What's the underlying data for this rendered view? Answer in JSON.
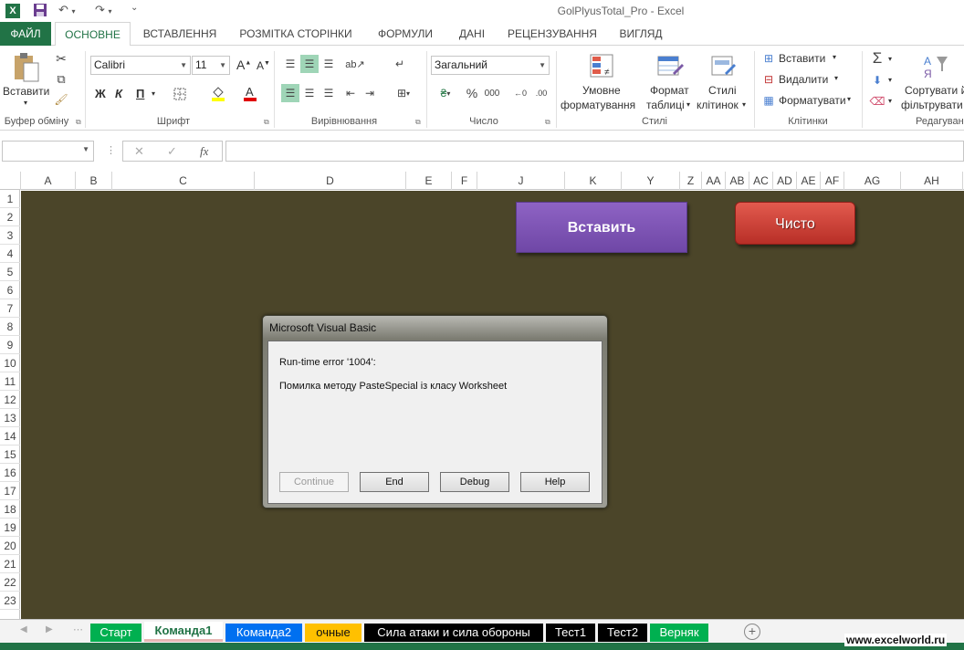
{
  "window": {
    "title": "GolPlyusTotal_Pro - Excel"
  },
  "ribbon_tabs": [
    "ФАЙЛ",
    "ОСНОВНЕ",
    "ВСТАВЛЕННЯ",
    "РОЗМІТКА СТОРІНКИ",
    "ФОРМУЛИ",
    "ДАНІ",
    "РЕЦЕНЗУВАННЯ",
    "ВИГЛЯД"
  ],
  "ribbon": {
    "clipboard": {
      "paste_label": "Вставити",
      "group_label": "Буфер обміну"
    },
    "font": {
      "name": "Calibri",
      "size": "11",
      "bold": "Ж",
      "italic": "К",
      "underline": "П",
      "group_label": "Шрифт"
    },
    "alignment": {
      "group_label": "Вирівнювання"
    },
    "number": {
      "format": "Загальний",
      "group_label": "Число"
    },
    "styles": {
      "conditional_line1": "Умовне",
      "conditional_line2": "форматування",
      "table_line1": "Формат",
      "table_line2": "таблиці",
      "cell_line1": "Стилі",
      "cell_line2": "клітинок",
      "group_label": "Стилі"
    },
    "cells": {
      "insert": "Вставити",
      "delete": "Видалити",
      "format": "Форматувати",
      "group_label": "Клітинки"
    },
    "editing": {
      "sort_line1": "Сортувати й",
      "sort_line2": "фільтрувати",
      "group_label": "Редагуван"
    }
  },
  "formula_bar": {
    "fx": "fx",
    "cancel": "✕",
    "enter": "✓"
  },
  "columns": [
    "A",
    "B",
    "C",
    "D",
    "E",
    "F",
    "J",
    "K",
    "Y",
    "Z",
    "AA",
    "AB",
    "AC",
    "AD",
    "AE",
    "AF",
    "AG",
    "AH"
  ],
  "rows": [
    "1",
    "2",
    "3",
    "4",
    "5",
    "6",
    "7",
    "8",
    "9",
    "10",
    "11",
    "12",
    "13",
    "14",
    "15",
    "16",
    "17",
    "18",
    "19",
    "20",
    "21",
    "22",
    "23"
  ],
  "shapes": {
    "insert_label": "Вставить",
    "clear_label": "Чисто"
  },
  "dialog": {
    "title": "Microsoft Visual Basic",
    "error_line": "Run-time error '1004':",
    "message": "Помилка методу PasteSpecial із класу Worksheet",
    "buttons": {
      "continue": "Continue",
      "end": "End",
      "debug": "Debug",
      "help": "Help"
    }
  },
  "sheet_tabs": [
    {
      "label": "Старт",
      "color": "#00b050"
    },
    {
      "label": "Команда1",
      "color": "#e8b7b4",
      "active": true
    },
    {
      "label": "Команда2",
      "color": "#0070f0"
    },
    {
      "label": "очные",
      "color": "#ffc000"
    },
    {
      "label": "Сила атаки и сила обороны",
      "color": "#000000"
    },
    {
      "label": "Тест1",
      "color": "#000000"
    },
    {
      "label": "Тест2",
      "color": "#000000"
    },
    {
      "label": "Верняк",
      "color": "#00b050"
    }
  ],
  "colors": {
    "excel_green": "#217346",
    "sheet_background": "#4b4529",
    "insert_button": "#7a52b3",
    "clear_button": "#c63b32"
  },
  "watermark": "www.excelworld.ru"
}
